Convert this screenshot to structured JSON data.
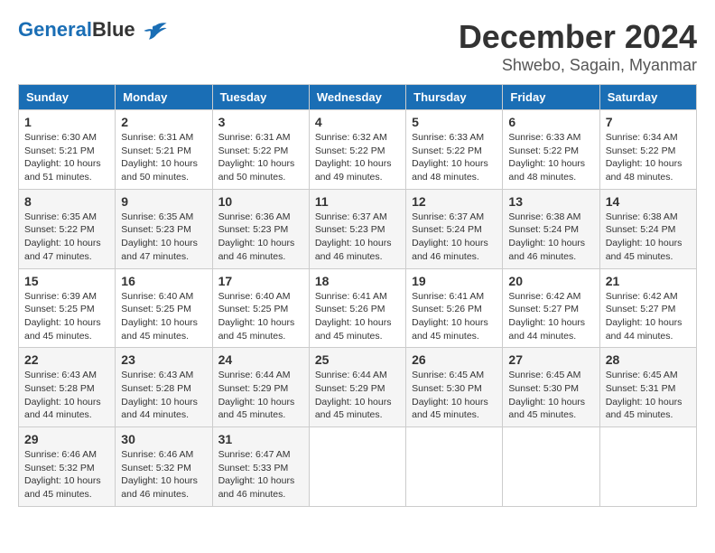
{
  "header": {
    "logo_line1": "General",
    "logo_line2": "Blue",
    "month_year": "December 2024",
    "location": "Shwebo, Sagain, Myanmar"
  },
  "days_of_week": [
    "Sunday",
    "Monday",
    "Tuesday",
    "Wednesday",
    "Thursday",
    "Friday",
    "Saturday"
  ],
  "weeks": [
    [
      {
        "day": "1",
        "sunrise": "6:30 AM",
        "sunset": "5:21 PM",
        "daylight": "10 hours and 51 minutes."
      },
      {
        "day": "2",
        "sunrise": "6:31 AM",
        "sunset": "5:21 PM",
        "daylight": "10 hours and 50 minutes."
      },
      {
        "day": "3",
        "sunrise": "6:31 AM",
        "sunset": "5:22 PM",
        "daylight": "10 hours and 50 minutes."
      },
      {
        "day": "4",
        "sunrise": "6:32 AM",
        "sunset": "5:22 PM",
        "daylight": "10 hours and 49 minutes."
      },
      {
        "day": "5",
        "sunrise": "6:33 AM",
        "sunset": "5:22 PM",
        "daylight": "10 hours and 48 minutes."
      },
      {
        "day": "6",
        "sunrise": "6:33 AM",
        "sunset": "5:22 PM",
        "daylight": "10 hours and 48 minutes."
      },
      {
        "day": "7",
        "sunrise": "6:34 AM",
        "sunset": "5:22 PM",
        "daylight": "10 hours and 48 minutes."
      }
    ],
    [
      {
        "day": "8",
        "sunrise": "6:35 AM",
        "sunset": "5:22 PM",
        "daylight": "10 hours and 47 minutes."
      },
      {
        "day": "9",
        "sunrise": "6:35 AM",
        "sunset": "5:23 PM",
        "daylight": "10 hours and 47 minutes."
      },
      {
        "day": "10",
        "sunrise": "6:36 AM",
        "sunset": "5:23 PM",
        "daylight": "10 hours and 46 minutes."
      },
      {
        "day": "11",
        "sunrise": "6:37 AM",
        "sunset": "5:23 PM",
        "daylight": "10 hours and 46 minutes."
      },
      {
        "day": "12",
        "sunrise": "6:37 AM",
        "sunset": "5:24 PM",
        "daylight": "10 hours and 46 minutes."
      },
      {
        "day": "13",
        "sunrise": "6:38 AM",
        "sunset": "5:24 PM",
        "daylight": "10 hours and 46 minutes."
      },
      {
        "day": "14",
        "sunrise": "6:38 AM",
        "sunset": "5:24 PM",
        "daylight": "10 hours and 45 minutes."
      }
    ],
    [
      {
        "day": "15",
        "sunrise": "6:39 AM",
        "sunset": "5:25 PM",
        "daylight": "10 hours and 45 minutes."
      },
      {
        "day": "16",
        "sunrise": "6:40 AM",
        "sunset": "5:25 PM",
        "daylight": "10 hours and 45 minutes."
      },
      {
        "day": "17",
        "sunrise": "6:40 AM",
        "sunset": "5:25 PM",
        "daylight": "10 hours and 45 minutes."
      },
      {
        "day": "18",
        "sunrise": "6:41 AM",
        "sunset": "5:26 PM",
        "daylight": "10 hours and 45 minutes."
      },
      {
        "day": "19",
        "sunrise": "6:41 AM",
        "sunset": "5:26 PM",
        "daylight": "10 hours and 45 minutes."
      },
      {
        "day": "20",
        "sunrise": "6:42 AM",
        "sunset": "5:27 PM",
        "daylight": "10 hours and 44 minutes."
      },
      {
        "day": "21",
        "sunrise": "6:42 AM",
        "sunset": "5:27 PM",
        "daylight": "10 hours and 44 minutes."
      }
    ],
    [
      {
        "day": "22",
        "sunrise": "6:43 AM",
        "sunset": "5:28 PM",
        "daylight": "10 hours and 44 minutes."
      },
      {
        "day": "23",
        "sunrise": "6:43 AM",
        "sunset": "5:28 PM",
        "daylight": "10 hours and 44 minutes."
      },
      {
        "day": "24",
        "sunrise": "6:44 AM",
        "sunset": "5:29 PM",
        "daylight": "10 hours and 45 minutes."
      },
      {
        "day": "25",
        "sunrise": "6:44 AM",
        "sunset": "5:29 PM",
        "daylight": "10 hours and 45 minutes."
      },
      {
        "day": "26",
        "sunrise": "6:45 AM",
        "sunset": "5:30 PM",
        "daylight": "10 hours and 45 minutes."
      },
      {
        "day": "27",
        "sunrise": "6:45 AM",
        "sunset": "5:30 PM",
        "daylight": "10 hours and 45 minutes."
      },
      {
        "day": "28",
        "sunrise": "6:45 AM",
        "sunset": "5:31 PM",
        "daylight": "10 hours and 45 minutes."
      }
    ],
    [
      {
        "day": "29",
        "sunrise": "6:46 AM",
        "sunset": "5:32 PM",
        "daylight": "10 hours and 45 minutes."
      },
      {
        "day": "30",
        "sunrise": "6:46 AM",
        "sunset": "5:32 PM",
        "daylight": "10 hours and 46 minutes."
      },
      {
        "day": "31",
        "sunrise": "6:47 AM",
        "sunset": "5:33 PM",
        "daylight": "10 hours and 46 minutes."
      },
      null,
      null,
      null,
      null
    ]
  ]
}
